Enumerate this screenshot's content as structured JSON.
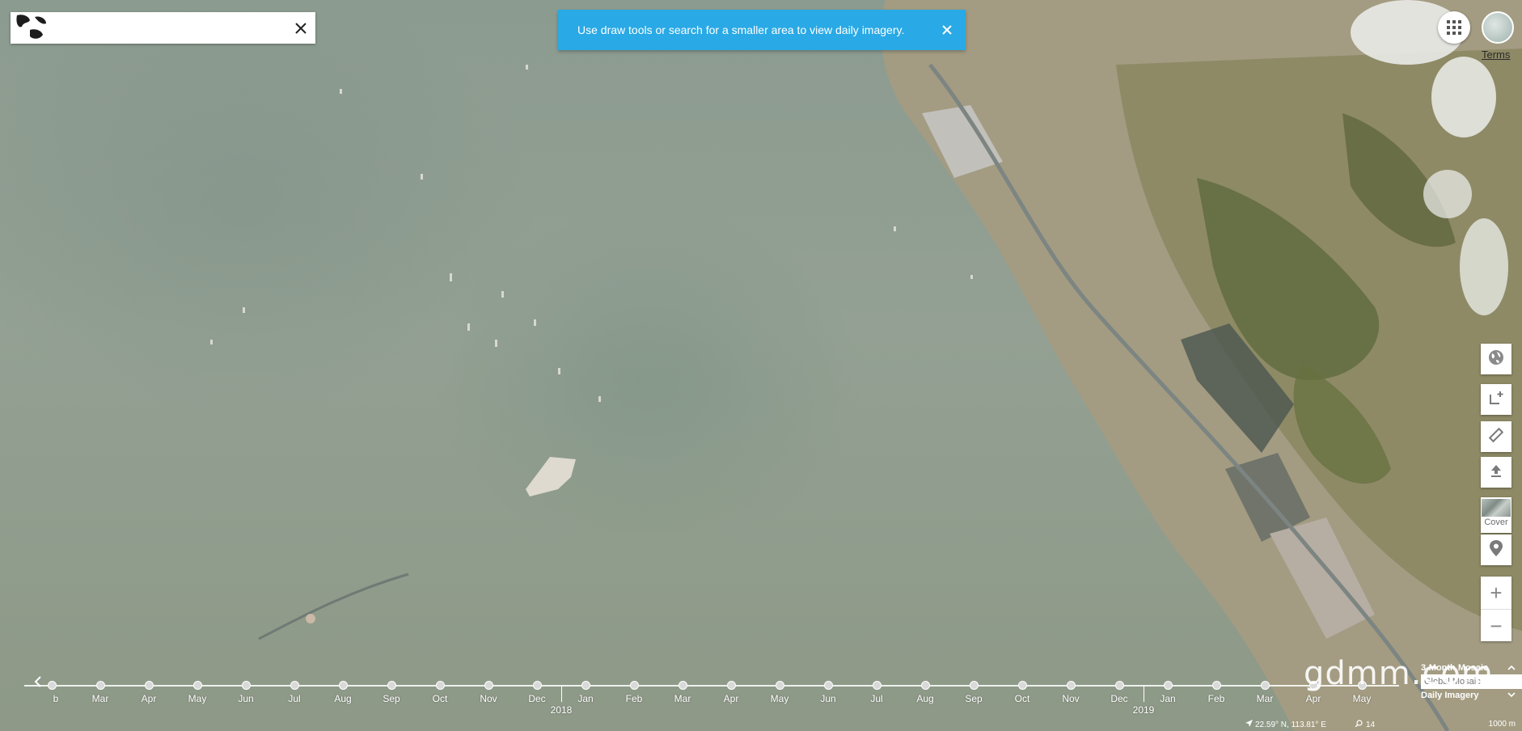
{
  "search": {
    "placeholder": "",
    "value": ""
  },
  "banner": {
    "text": "Use draw tools or search for a smaller area to view daily imagery."
  },
  "header": {
    "terms_label": "Terms"
  },
  "toolbar": {
    "cover_label": "Cover",
    "zoom_in": "+",
    "zoom_out": "−"
  },
  "timeline": {
    "start_partial_label": "b",
    "months": [
      "Mar",
      "Apr",
      "May",
      "Jun",
      "Jul",
      "Aug",
      "Sep",
      "Oct",
      "Nov",
      "Dec",
      "Jan",
      "Feb",
      "Mar",
      "Apr",
      "May",
      "Jun",
      "Jul",
      "Aug",
      "Sep",
      "Oct",
      "Nov",
      "Dec",
      "Jan",
      "Feb",
      "Mar",
      "Apr",
      "May"
    ],
    "years": [
      "2018",
      "2019"
    ],
    "mosaic_option": "3-Month Mosaic",
    "mosaic_input_placeholder": "Global Mosaic",
    "daily_option": "Daily Imagery"
  },
  "status": {
    "coordinates": "22.59° N, 113.81° E",
    "zoom": "14",
    "scale": "1000 m"
  },
  "watermark": "gdmm.com",
  "colors": {
    "banner": "#29a9e5",
    "water": "#8f998b"
  },
  "icons": [
    "globe-icon",
    "close-icon",
    "apps-grid-icon",
    "draw-area-icon",
    "ruler-icon",
    "upload-icon",
    "location-pin-icon",
    "chevron-up-icon",
    "chevron-down-icon",
    "navigation-arrow-icon",
    "magnifier-icon"
  ]
}
